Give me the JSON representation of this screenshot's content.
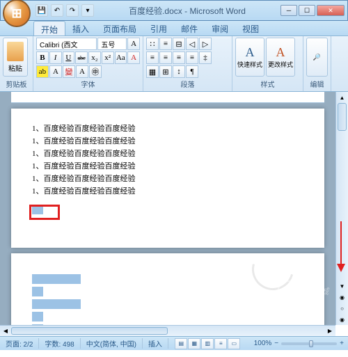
{
  "title_bar": {
    "doc_title": "百度经验.docx - Microsoft Word"
  },
  "tabs": {
    "home": "开始",
    "insert": "插入",
    "layout": "页面布局",
    "reference": "引用",
    "mail": "邮件",
    "review": "审阅",
    "view": "视图"
  },
  "ribbon": {
    "clipboard": {
      "paste": "粘贴",
      "label": "剪贴板"
    },
    "font": {
      "family": "Calibri (西文",
      "size": "五号",
      "bold": "B",
      "italic": "I",
      "underline": "U",
      "strike": "abc",
      "sub": "x₂",
      "sup": "x²",
      "label": "字体"
    },
    "paragraph": {
      "label": "段落"
    },
    "styles": {
      "quick": "快速样式",
      "change": "更改样式",
      "label": "样式"
    },
    "editing": {
      "label": "编辑"
    }
  },
  "document": {
    "list_items": [
      "1、百度经验百度经验百度经验",
      "1、百度经验百度经验百度经验",
      "1、百度经验百度经验百度经验",
      "1、百度经验百度经验百度经验",
      "1、百度经验百度经验百度经验",
      "1、百度经验百度经验百度经验"
    ]
  },
  "status_bar": {
    "page": "页面: 2/2",
    "words": "字数: 498",
    "lang": "中文(简体, 中国)",
    "mode": "插入",
    "zoom": "100%",
    "zoom_btns": {
      "minus": "−",
      "plus": "+"
    }
  },
  "watermark": "系统城"
}
